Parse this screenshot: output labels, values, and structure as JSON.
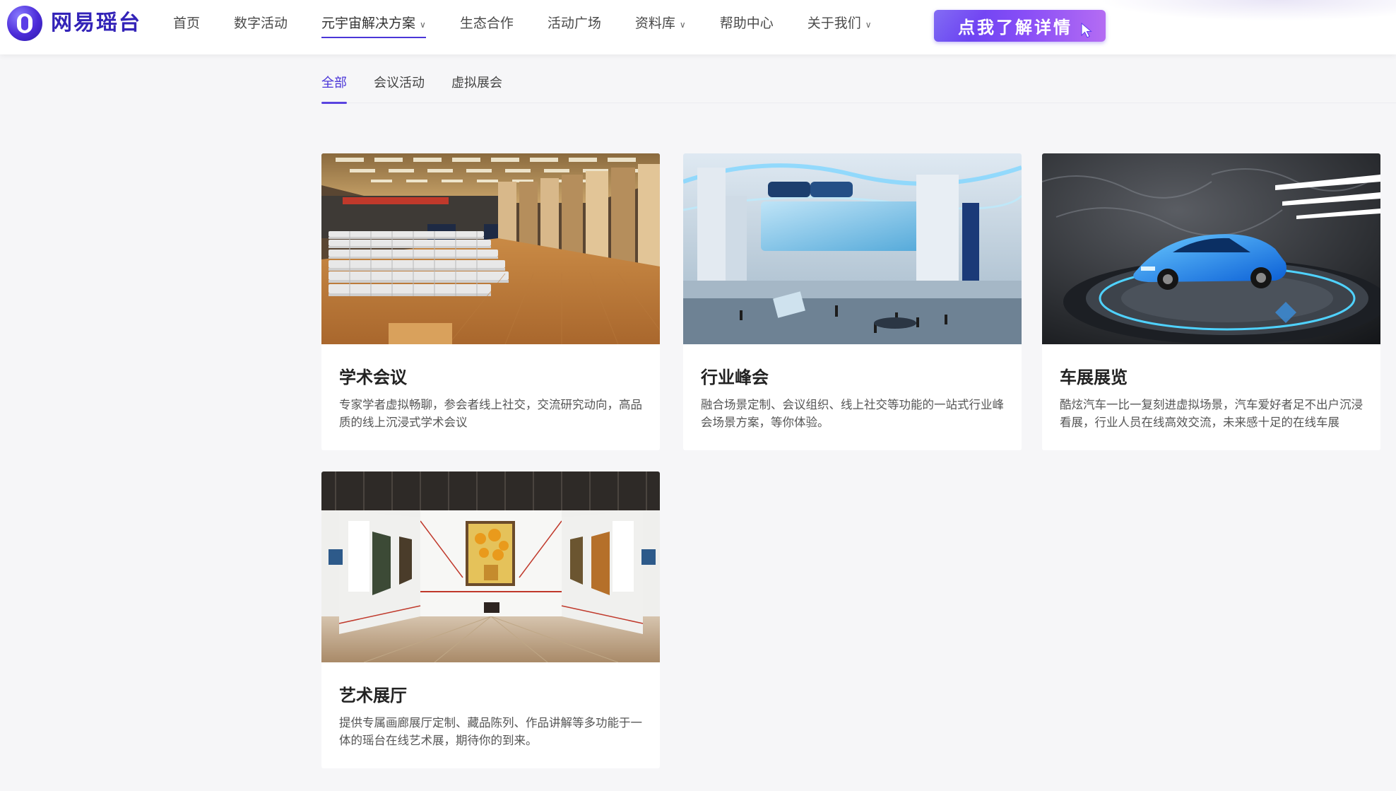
{
  "brand": {
    "name": "网易瑶台"
  },
  "nav": {
    "items": [
      {
        "label": "首页",
        "has_dropdown": false,
        "active": false
      },
      {
        "label": "数字活动",
        "has_dropdown": false,
        "active": false
      },
      {
        "label": "元宇宙解决方案",
        "has_dropdown": true,
        "active": true
      },
      {
        "label": "生态合作",
        "has_dropdown": false,
        "active": false
      },
      {
        "label": "活动广场",
        "has_dropdown": false,
        "active": false
      },
      {
        "label": "资料库",
        "has_dropdown": true,
        "active": false
      },
      {
        "label": "帮助中心",
        "has_dropdown": false,
        "active": false
      },
      {
        "label": "关于我们",
        "has_dropdown": true,
        "active": false
      }
    ],
    "promo_label": "点我了解详情"
  },
  "tabs": {
    "items": [
      {
        "label": "全部",
        "active": true
      },
      {
        "label": "会议活动",
        "active": false
      },
      {
        "label": "虚拟展会",
        "active": false
      }
    ]
  },
  "cards": [
    {
      "title": "学术会议",
      "desc": "专家学者虚拟畅聊，参会者线上社交，交流研究动向，高品质的线上沉浸式学术会议",
      "image": "auditorium"
    },
    {
      "title": "行业峰会",
      "desc": "融合场景定制、会议组织、线上社交等功能的一站式行业峰会场景方案，等你体验。",
      "image": "virtual-summit-hall"
    },
    {
      "title": "车展展览",
      "desc": "酷炫汽车一比一复刻进虚拟场景，汽车爱好者足不出户沉浸看展，行业人员在线高效交流，未来感十足的在线车展",
      "image": "car-showroom"
    },
    {
      "title": "艺术展厅",
      "desc": "提供专属画廊展厅定制、藏品陈列、作品讲解等多功能于一体的瑶台在线艺术展，期待你的到来。",
      "image": "art-gallery"
    }
  ],
  "colors": {
    "accent": "#4b36d8",
    "background": "#f6f6f8"
  }
}
